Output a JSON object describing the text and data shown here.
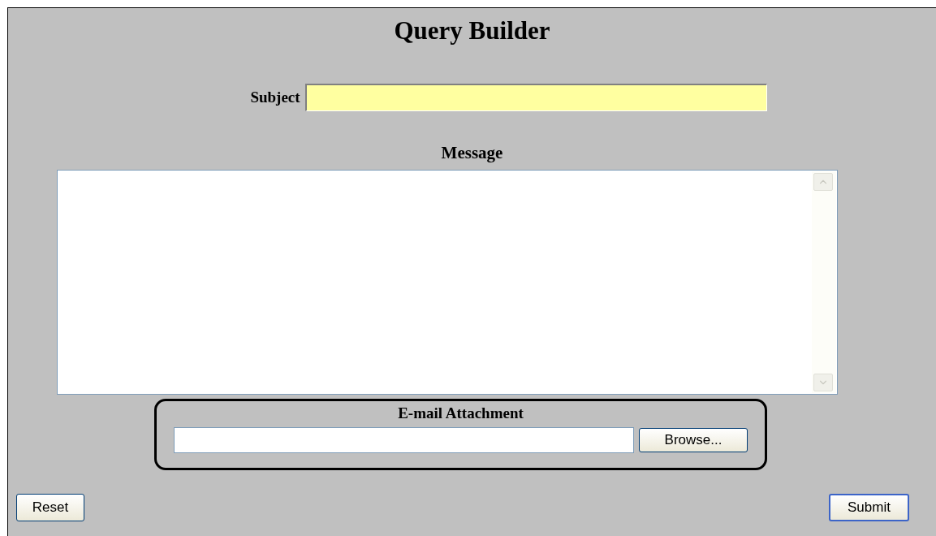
{
  "title": "Query Builder",
  "subject": {
    "label": "Subject"
  },
  "message": {
    "label": "Message"
  },
  "attachment": {
    "label": "E-mail Attachment",
    "button": "Browse..."
  },
  "buttons": {
    "reset": "Reset",
    "submit": "Submit"
  }
}
